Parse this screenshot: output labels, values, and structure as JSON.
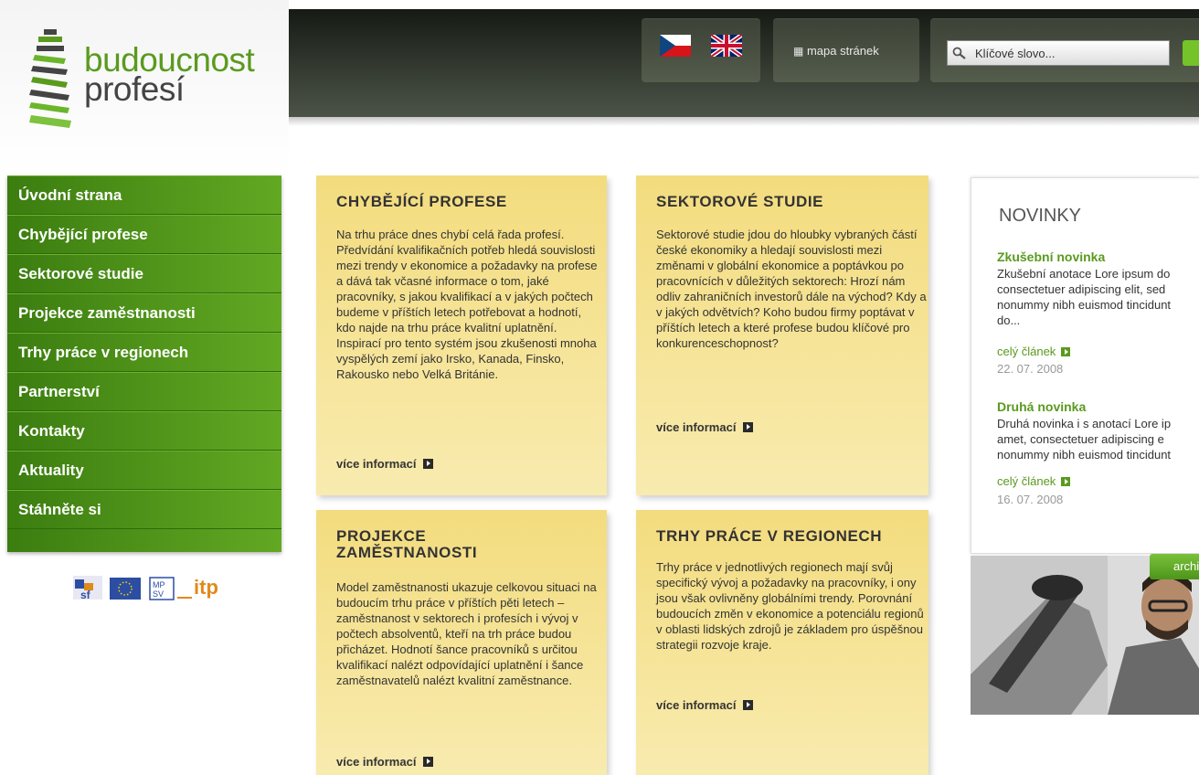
{
  "logo": {
    "line1": "budoucnost",
    "line2": "profesí"
  },
  "header": {
    "sitemap_label": "mapa stránek",
    "search_placeholder": "Klíčové slovo..."
  },
  "nav": {
    "items": [
      {
        "label": "Úvodní strana"
      },
      {
        "label": "Chybějící profese"
      },
      {
        "label": "Sektorové studie"
      },
      {
        "label": "Projekce zaměstnanosti"
      },
      {
        "label": "Trhy práce v regionech"
      },
      {
        "label": "Partnerství"
      },
      {
        "label": "Kontakty"
      },
      {
        "label": "Aktuality"
      },
      {
        "label": "Stáhněte si"
      }
    ]
  },
  "cards": [
    {
      "title": "CHYBĚJÍCÍ PROFESE",
      "body": "Na trhu práce dnes chybí celá řada profesí. Předvídání kvalifikačních potřeb hledá souvislosti mezi trendy v ekonomice a požadavky na profese a dává tak včasné informace o tom, jaké pracovníky, s jakou kvalifikací a v jakých počtech budeme v příštích letech potřebovat a hodnotí, kdo najde na trhu práce kvalitní uplatnění. Inspirací pro tento systém jsou zkušenosti mnoha vyspělých zemí jako Irsko, Kanada, Finsko, Rakousko nebo Velká Británie.",
      "more": "více informací"
    },
    {
      "title": "SEKTOROVÉ STUDIE",
      "body": "Sektorové studie jdou do hloubky vybraných částí české ekonomiky a hledají souvislosti mezi změnami v globální ekonomice a poptávkou po pracovnících v důležitých sektorech: Hrozí nám odliv zahraničních investorů dále na východ? Kdy a v jakých odvětvích? Koho budou firmy poptávat v příštích letech a které profese budou klíčové pro konkurenceschopnost?",
      "more": "více informací"
    },
    {
      "title": "PROJEKCE ZAMĚSTNANOSTI",
      "body": "Model zaměstnanosti ukazuje celkovou situaci na budoucím trhu práce v příštích pěti letech – zaměstnanost v sektorech i profesích i vývoj v počtech absolventů, kteří na trh práce budou přicházet. Hodnotí šance pracovníků s určitou kvalifikací nalézt odpovídající uplatnění i šance zaměstnavatelů nalézt kvalitní zaměstnance.",
      "more": "více informací"
    },
    {
      "title": "TRHY PRÁCE V REGIONECH",
      "body": "Trhy práce v jednotlivých regionech mají svůj specifický vývoj a požadavky na pracovníky, i ony jsou však ovlivněny globálními trendy. Porovnání budoucích změn v ekonomice a potenciálu regionů v oblasti lidských zdrojů je základem pro úspěšnou strategii rozvoje kraje.",
      "more": "více informací"
    }
  ],
  "news": {
    "title": "NOVINKY",
    "items": [
      {
        "title": "Zkušební novinka",
        "text": "Zkušební anotace Lore ipsum do\nconsectetuer adipiscing elit, sed\nnonummy nibh euismod tincidunt\ndo...",
        "link": "celý článek",
        "date": "22. 07. 2008"
      },
      {
        "title": "Druhá novinka",
        "text": "Druhá novinka i s anotací Lore ip\namet, consectetuer adipiscing e\nnonummy nibh euismod tincidunt",
        "link": "celý článek",
        "date": "16. 07. 2008"
      }
    ],
    "archive_label": "archiv"
  },
  "colors": {
    "brand_green": "#5a9a1e",
    "nav_green": "#4c9118",
    "card_yellow": "#f5e08c"
  }
}
